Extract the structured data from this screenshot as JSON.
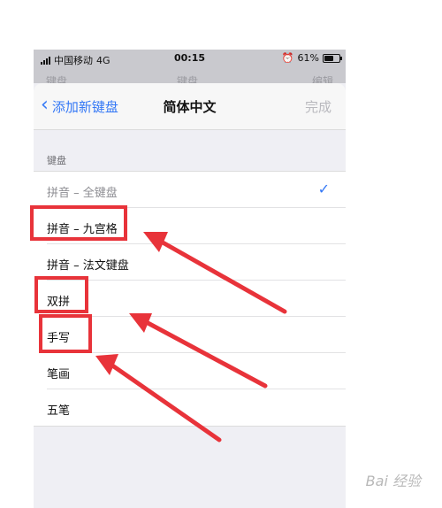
{
  "status_bar": {
    "carrier": "中国移动",
    "network": "4G",
    "time": "00:15",
    "battery": "61%",
    "battery_level": 0.61,
    "alarm_icon": "alarm-clock-icon"
  },
  "background_nav": {
    "left_label": "键盘",
    "title": "键盘",
    "right_label": "编辑"
  },
  "nav": {
    "back_label": "添加新键盘",
    "title": "简体中文",
    "done_label": "完成"
  },
  "section_header": "键盘",
  "keyboards": [
    {
      "label": "拼音 – 全键盘",
      "checked": true,
      "disabled": true
    },
    {
      "label": "拼音 – 九宫格",
      "checked": false,
      "disabled": false
    },
    {
      "label": "拼音 – 法文键盘",
      "checked": false,
      "disabled": false
    },
    {
      "label": "双拼",
      "checked": false,
      "disabled": false
    },
    {
      "label": "手写",
      "checked": false,
      "disabled": false
    },
    {
      "label": "笔画",
      "checked": false,
      "disabled": false
    },
    {
      "label": "五笔",
      "checked": false,
      "disabled": false
    }
  ],
  "check_icon": "checkmark-icon",
  "colors": {
    "accent": "#3478f6",
    "annotation": "#e8333a"
  },
  "watermark": "Bai 经验"
}
